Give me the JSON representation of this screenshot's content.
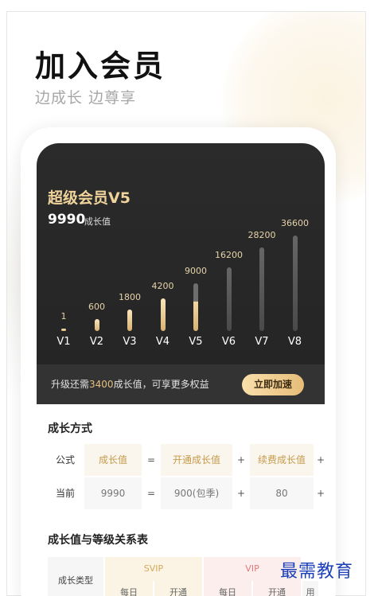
{
  "page": {
    "title": "加入会员",
    "subtitle": "边成长 边尊享"
  },
  "card": {
    "level_title": "超级会员V5",
    "growth_value": "9990",
    "growth_unit": "成长值",
    "levels": [
      {
        "label": "V1",
        "value": "1",
        "state": "on",
        "fill": 1.0
      },
      {
        "label": "V2",
        "value": "600",
        "state": "on",
        "fill": 1.0
      },
      {
        "label": "V3",
        "value": "1800",
        "state": "on",
        "fill": 1.0
      },
      {
        "label": "V4",
        "value": "4200",
        "state": "on",
        "fill": 1.0
      },
      {
        "label": "V5",
        "value": "9000",
        "state": "half",
        "fill": 0.62
      },
      {
        "label": "V6",
        "value": "16200",
        "state": "off",
        "fill": 0
      },
      {
        "label": "V7",
        "value": "28200",
        "state": "off",
        "fill": 0
      },
      {
        "label": "V8",
        "value": "36600",
        "state": "off",
        "fill": 0
      }
    ],
    "upgrade_prefix": "升级还需",
    "upgrade_amount": "3400",
    "upgrade_suffix": "成长值，可享更多权益",
    "upgrade_button": "立即加速"
  },
  "growth_method": {
    "title": "成长方式",
    "formula_label": "公式",
    "formula": [
      "成长值",
      "=",
      "开通成长值",
      "+",
      "续费成长值",
      "+"
    ],
    "current_label": "当前",
    "current": [
      "9990",
      "=",
      "900(包季)",
      "+",
      "80",
      "+"
    ]
  },
  "relation_table": {
    "title": "成长值与等级关系表",
    "type_label": "成长类型",
    "svip_label": "SVIP",
    "vip_label": "VIP",
    "svip_cols": [
      "每日",
      "开通"
    ],
    "vip_cols": [
      "每日",
      "开通"
    ],
    "extra": "用"
  },
  "watermark": "最需教育",
  "colors": {
    "accent_gold": "#e4c080",
    "dark_card": "#2b2b2b",
    "svip_head_bg": "#fbf4e4",
    "vip_head_bg": "#fdeeee",
    "vip_text": "#e07a7a",
    "svip_text": "#d2a95c"
  }
}
